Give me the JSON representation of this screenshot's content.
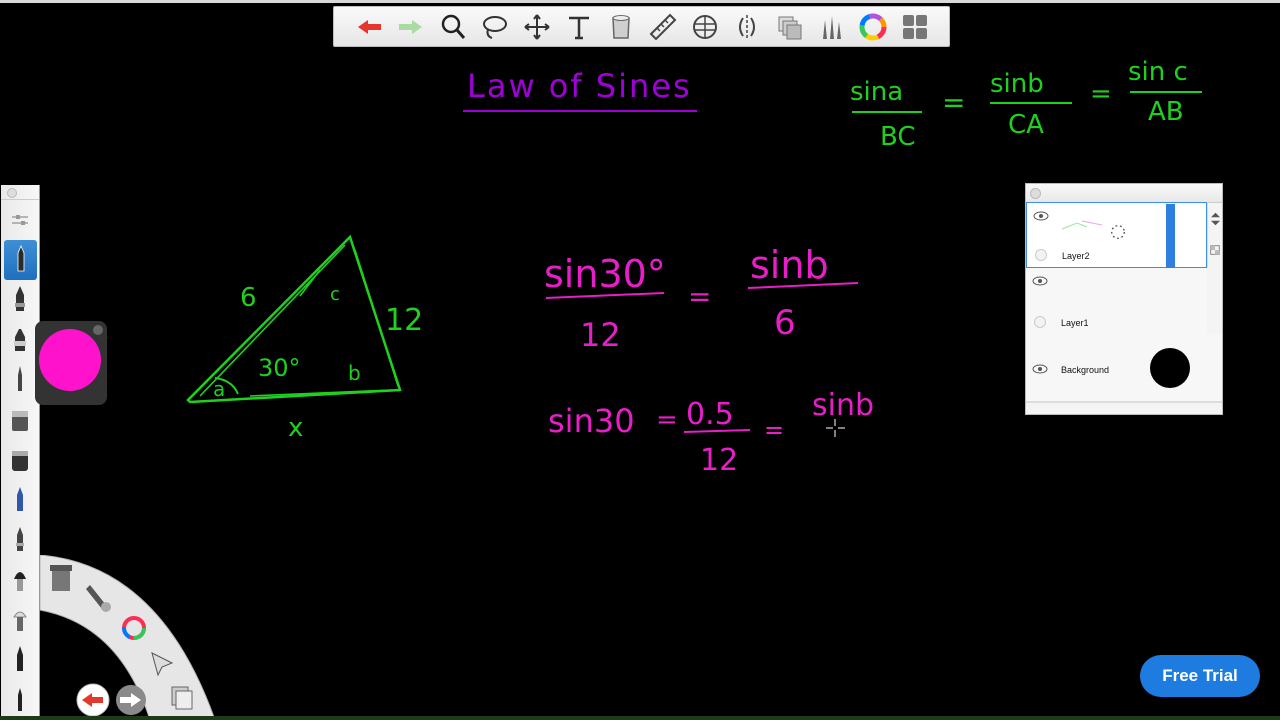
{
  "toolbar": {
    "tools": [
      "undo-icon",
      "redo-icon",
      "zoom-icon",
      "lasso-icon",
      "transform-icon",
      "text-icon",
      "fill-icon",
      "ruler-icon",
      "symmetry-icon",
      "perspective-icon",
      "layers-icon",
      "brush-library-icon",
      "color-wheel-icon",
      "ui-toggle-icon"
    ]
  },
  "colors": {
    "ink_green": "#1fd11f",
    "ink_purple": "#a000d8",
    "ink_magenta": "#e81ec8",
    "current_color": "#ff12cc",
    "accent_blue": "#1e7be0"
  },
  "canvas": {
    "title": "Law of Sines",
    "formula": {
      "n1": "sina",
      "d1": "BC",
      "eq": "=",
      "n2": "sinb",
      "d2": "CA",
      "n3": "sin c",
      "d3": "AB"
    },
    "triangle": {
      "side_top": "6",
      "side_right": "12",
      "side_bottom": "x",
      "angle_a": "a",
      "angle_deg": "30°",
      "angle_b": "b",
      "angle_c": "c"
    },
    "eq1": {
      "n1": "sin30°",
      "d1": "12",
      "eq": "=",
      "n2": "sinb",
      "d2": "6"
    },
    "eq2": {
      "lhs": "sin30",
      "eq1": "=",
      "val": "0.5",
      "den": "12",
      "eq2": "=",
      "rhs": "sinb"
    }
  },
  "layers": {
    "items": [
      {
        "name": "Layer2",
        "selected": true
      },
      {
        "name": "Layer1",
        "selected": false
      },
      {
        "name": "Background",
        "selected": false
      }
    ]
  },
  "free_trial": {
    "label": "Free Trial"
  }
}
